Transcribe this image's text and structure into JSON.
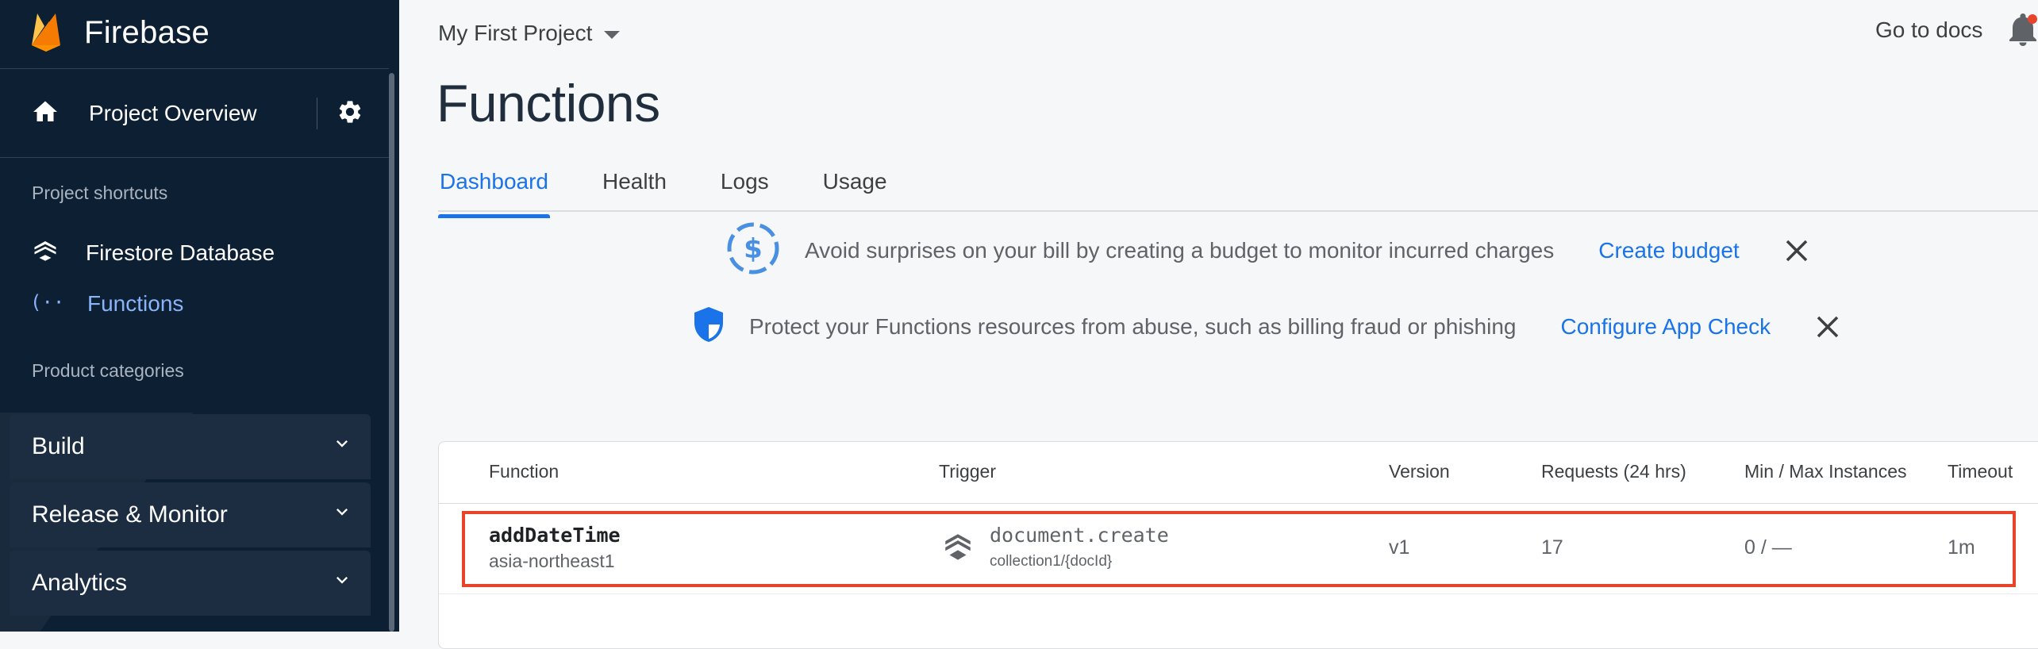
{
  "sidebar": {
    "brand": "Firebase",
    "project_overview": "Project Overview",
    "shortcuts_heading": "Project shortcuts",
    "shortcuts": [
      {
        "label": "Firestore Database",
        "icon": "firestore-icon"
      },
      {
        "label": "Functions",
        "icon": "functions-icon",
        "active": true
      }
    ],
    "categories_heading": "Product categories",
    "categories": [
      {
        "label": "Build"
      },
      {
        "label": "Release & Monitor"
      },
      {
        "label": "Analytics"
      }
    ]
  },
  "header": {
    "project": "My First Project",
    "docs_link": "Go to docs"
  },
  "page": {
    "title": "Functions",
    "tabs": [
      {
        "label": "Dashboard",
        "active": true
      },
      {
        "label": "Health"
      },
      {
        "label": "Logs"
      },
      {
        "label": "Usage"
      }
    ]
  },
  "banners": [
    {
      "message": "Avoid surprises on your bill by creating a budget to monitor incurred charges",
      "action": "Create budget",
      "icon": "budget-icon"
    },
    {
      "message": "Protect your Functions resources from abuse, such as billing fraud or phishing",
      "action": "Configure App Check",
      "icon": "shield-icon"
    }
  ],
  "table": {
    "columns": [
      "Function",
      "Trigger",
      "Version",
      "Requests (24 hrs)",
      "Min / Max Instances",
      "Timeout"
    ],
    "rows": [
      {
        "name": "addDateTime",
        "region": "asia-northeast1",
        "trigger_event": "document.create",
        "trigger_path": "collection1/{docId}",
        "version": "v1",
        "requests": "17",
        "instances": "0 / —",
        "timeout": "1m"
      }
    ]
  },
  "colors": {
    "sidebar_bg": "#0d1f33",
    "accent": "#1a73e8",
    "highlight": "#e8432b",
    "firebase_orange": "#ffa000"
  }
}
